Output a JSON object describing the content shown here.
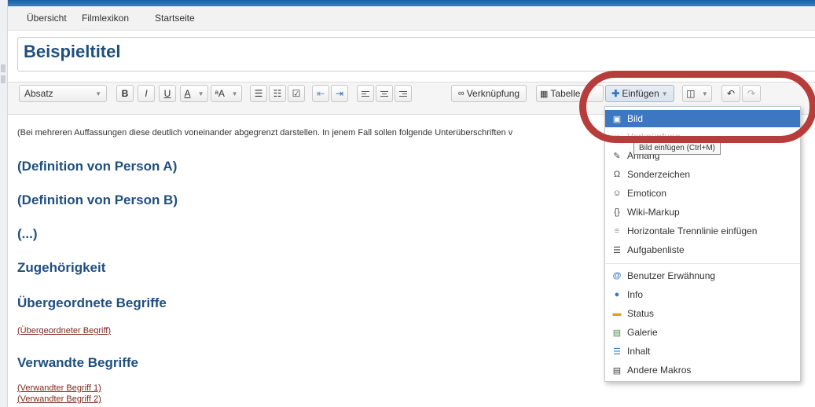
{
  "breadcrumb": [
    "Übersicht",
    "Filmlexikon",
    "Startseite"
  ],
  "page_title": "Beispieltitel",
  "toolbar": {
    "paragraph_select": "Absatz",
    "bold": "B",
    "italic": "I",
    "underline": "U",
    "text_color": "A",
    "font_size": "ᵃA",
    "link_button": "Verknüpfung",
    "table_button": "Tabelle",
    "insert_button": "Einfügen"
  },
  "content": {
    "intro": "(Bei mehreren Auffassungen diese deutlich voneinander abgegrenzt darstellen. In jenem Fall sollen folgende Unterüberschriften v",
    "headings": [
      "(Definition von Person A)",
      "(Definition von Person B)",
      "(...)",
      "Zugehörigkeit",
      "Übergeordnete Begriffe"
    ],
    "parent_term_link": "(Übergeordneter Begriff)",
    "related_heading": "Verwandte Begriffe",
    "related_links": [
      "(Verwandter Begriff 1)",
      "(Verwandter Begriff 2)"
    ]
  },
  "insert_menu": {
    "items": [
      "Bild",
      "Verknüpfung",
      "Anhang",
      "Sonderzeichen",
      "Emoticon",
      "Wiki-Markup",
      "Horizontale Trennlinie einfügen",
      "Aufgabenliste",
      "Benutzer Erwähnung",
      "Info",
      "Status",
      "Galerie",
      "Inhalt",
      "Andere Makros"
    ],
    "tooltip": "Bild einfügen (Ctrl+M)"
  },
  "colors": {
    "highlight": "#b73c3c",
    "menu_active": "#3d77c2",
    "heading": "#1f4f7f",
    "link": "#7a2a1c"
  }
}
